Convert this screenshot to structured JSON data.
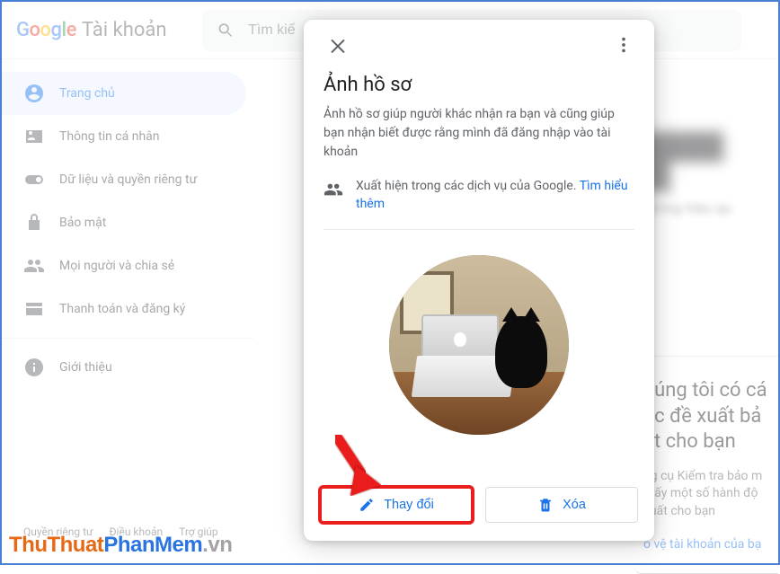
{
  "header": {
    "logo_account": "Tài khoản",
    "search_placeholder": "Tìm kiế"
  },
  "sidebar": {
    "items": [
      {
        "label": "Trang chủ"
      },
      {
        "label": "Thông tin cá nhân"
      },
      {
        "label": "Dữ liệu và quyền riêng tư"
      },
      {
        "label": "Bảo mật"
      },
      {
        "label": "Mọi người và chia sẻ"
      },
      {
        "label": "Thanh toán và đăng ký"
      }
    ],
    "about_label": "Giới thiệu",
    "footer": {
      "privacy": "Quyền riêng tư",
      "terms": "Điều khoản",
      "help": "Trợ giúp"
    }
  },
  "background": {
    "blur_subtitle": "hoạt động hiệu qu",
    "card_title": "húng tôi có cá\nục đề xuất bả\nật cho bạn",
    "card_desc": "ng cụ Kiểm tra bảo m\nthấy một số hành độ\nxuất cho bạn",
    "card_link": "o vệ tài khoản của bạ"
  },
  "modal": {
    "title": "Ảnh hồ sơ",
    "description": "Ảnh hồ sơ giúp người khác nhận ra bạn và cũng giúp bạn nhận biết được rằng mình đã đăng nhập vào tài khoản",
    "visibility_text": "Xuất hiện trong các dịch vụ của Google. ",
    "visibility_link": "Tìm hiểu thêm",
    "change_label": "Thay đổi",
    "delete_label": "Xóa"
  },
  "watermark": {
    "p1": "ThuThuat",
    "p2": "PhanMem",
    "p3": ".vn"
  }
}
